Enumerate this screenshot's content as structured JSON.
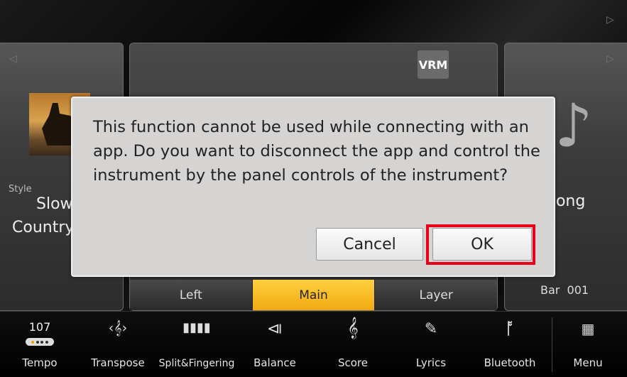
{
  "style_panel": {
    "label": "Style",
    "name_line1": "Slow",
    "name_line2": "Country"
  },
  "center_panel": {
    "vrm_label": "VRM",
    "part_tabs": [
      {
        "label": "Left",
        "active": false
      },
      {
        "label": "Main",
        "active": true
      },
      {
        "label": "Layer",
        "active": false
      }
    ]
  },
  "song_panel": {
    "song_name_partial": "Song",
    "bar_label": "Bar",
    "bar_value": "001"
  },
  "dialog": {
    "message": "This function cannot be used while connecting with an app. Do you want to disconnect the app and control the instrument by the panel controls of the instrument?",
    "cancel_label": "Cancel",
    "ok_label": "OK"
  },
  "bottom_bar": {
    "tempo_value": "107",
    "items": [
      {
        "label": "Tempo",
        "icon": "tempo-icon"
      },
      {
        "label": "Transpose",
        "icon": "transpose-icon"
      },
      {
        "label": "Split&Fingering",
        "icon": "keyboard-split-icon"
      },
      {
        "label": "Balance",
        "icon": "balance-slider-icon"
      },
      {
        "label": "Score",
        "icon": "treble-clef-icon"
      },
      {
        "label": "Lyrics",
        "icon": "lyrics-icon"
      },
      {
        "label": "Bluetooth",
        "icon": "bluetooth-icon"
      },
      {
        "label": "Menu",
        "icon": "grid-menu-icon"
      }
    ]
  },
  "colors": {
    "active_tab": "#f2aa10",
    "highlight_border": "#e8001a",
    "dialog_bg": "#d6d3d3"
  }
}
